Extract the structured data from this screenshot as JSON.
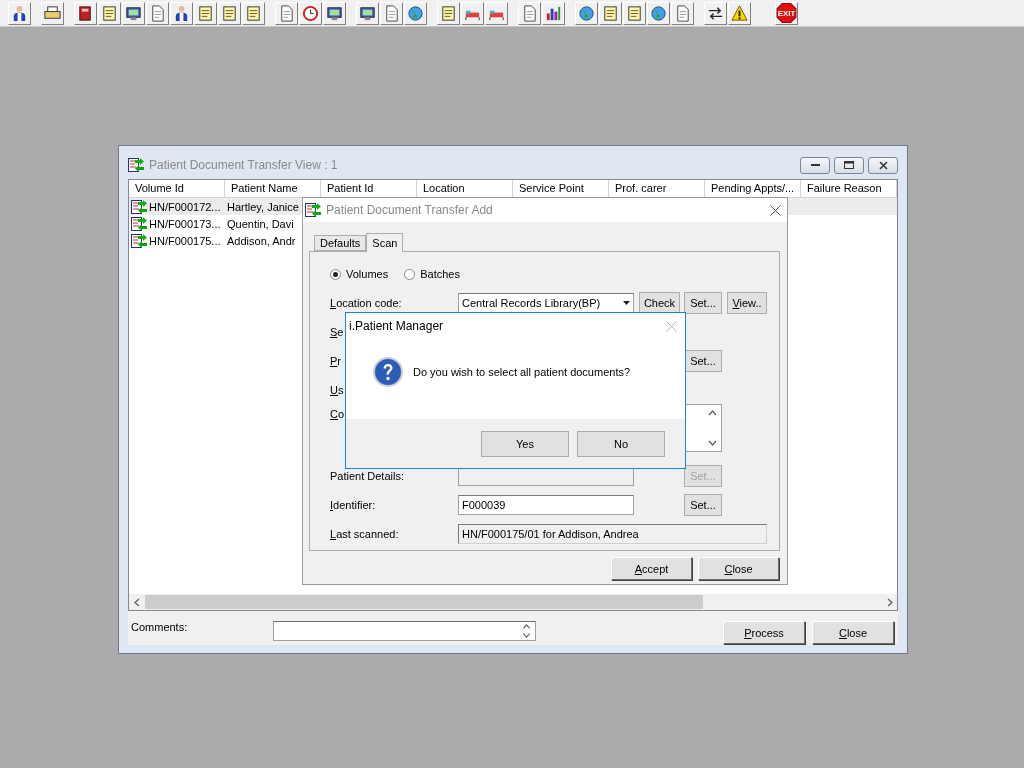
{
  "toolbar": {
    "exit_label": "EXIT"
  },
  "main_window": {
    "title": "Patient Document Transfer View : 1",
    "columns": [
      "Volume Id",
      "Patient Name",
      "Patient Id",
      "Location",
      "Service Point",
      "Prof. carer",
      "Pending Appts/...",
      "Failure Reason"
    ],
    "rows": [
      {
        "cells": [
          "HN/F000172...",
          "Hartley, Janice"
        ],
        "selected": true
      },
      {
        "cells": [
          "HN/F000173...",
          "Quentin, Davi"
        ],
        "selected": false
      },
      {
        "cells": [
          "HN/F000175...",
          "Addison, Andr"
        ],
        "selected": false
      }
    ],
    "comments_label": "Comments:",
    "buttons": [
      {
        "label": "Process",
        "mnemonic": true
      },
      {
        "label": "Close",
        "mnemonic": true
      }
    ]
  },
  "add_dialog": {
    "title": "Patient Document Transfer Add",
    "tabs": [
      {
        "label": "Defaults",
        "selected": false
      },
      {
        "label": "Scan",
        "selected": true
      }
    ],
    "radios": [
      {
        "label": "Volumes",
        "selected": true
      },
      {
        "label": "Batches",
        "selected": false
      }
    ],
    "rows": [
      {
        "kind": "combo",
        "label": "Location code:",
        "mnemonic": true,
        "value": "Central Records Library(BP)",
        "buttons": [
          {
            "label": "Check",
            "disabled": false
          },
          {
            "label": "Set...",
            "disabled": false
          },
          {
            "label": "View..",
            "mnemonic": true,
            "disabled": false
          }
        ]
      },
      {
        "kind": "hidden",
        "label": "Se",
        "mnemonic": true
      },
      {
        "kind": "hidden",
        "label": "Pr",
        "mnemonic": true,
        "buttons": [
          {
            "label": "Set...",
            "disabled": false
          }
        ]
      },
      {
        "kind": "hidden",
        "label": "Us",
        "mnemonic": true
      },
      {
        "kind": "memo",
        "label": "Co",
        "mnemonic": true
      },
      {
        "kind": "text",
        "label": "Patient Details:",
        "disabled": true,
        "buttons": [
          {
            "label": "Set...",
            "disabled": true
          }
        ]
      },
      {
        "kind": "text",
        "label": "Identifier:",
        "mnemonic": true,
        "value": "F000039",
        "disabled": false,
        "buttons": [
          {
            "label": "Set...",
            "disabled": false
          }
        ]
      },
      {
        "kind": "readonly",
        "label": "Last scanned:",
        "mnemonic": true,
        "value": "HN/F000175/01 for Addison, Andrea"
      }
    ],
    "buttons": [
      {
        "label": "Accept",
        "mnemonic": true
      },
      {
        "label": "Close",
        "mnemonic": true
      }
    ]
  },
  "message_box": {
    "title": "i.Patient Manager",
    "message": "Do you wish to select all patient documents?",
    "buttons": [
      {
        "label": "Yes"
      },
      {
        "label": "No"
      }
    ]
  }
}
